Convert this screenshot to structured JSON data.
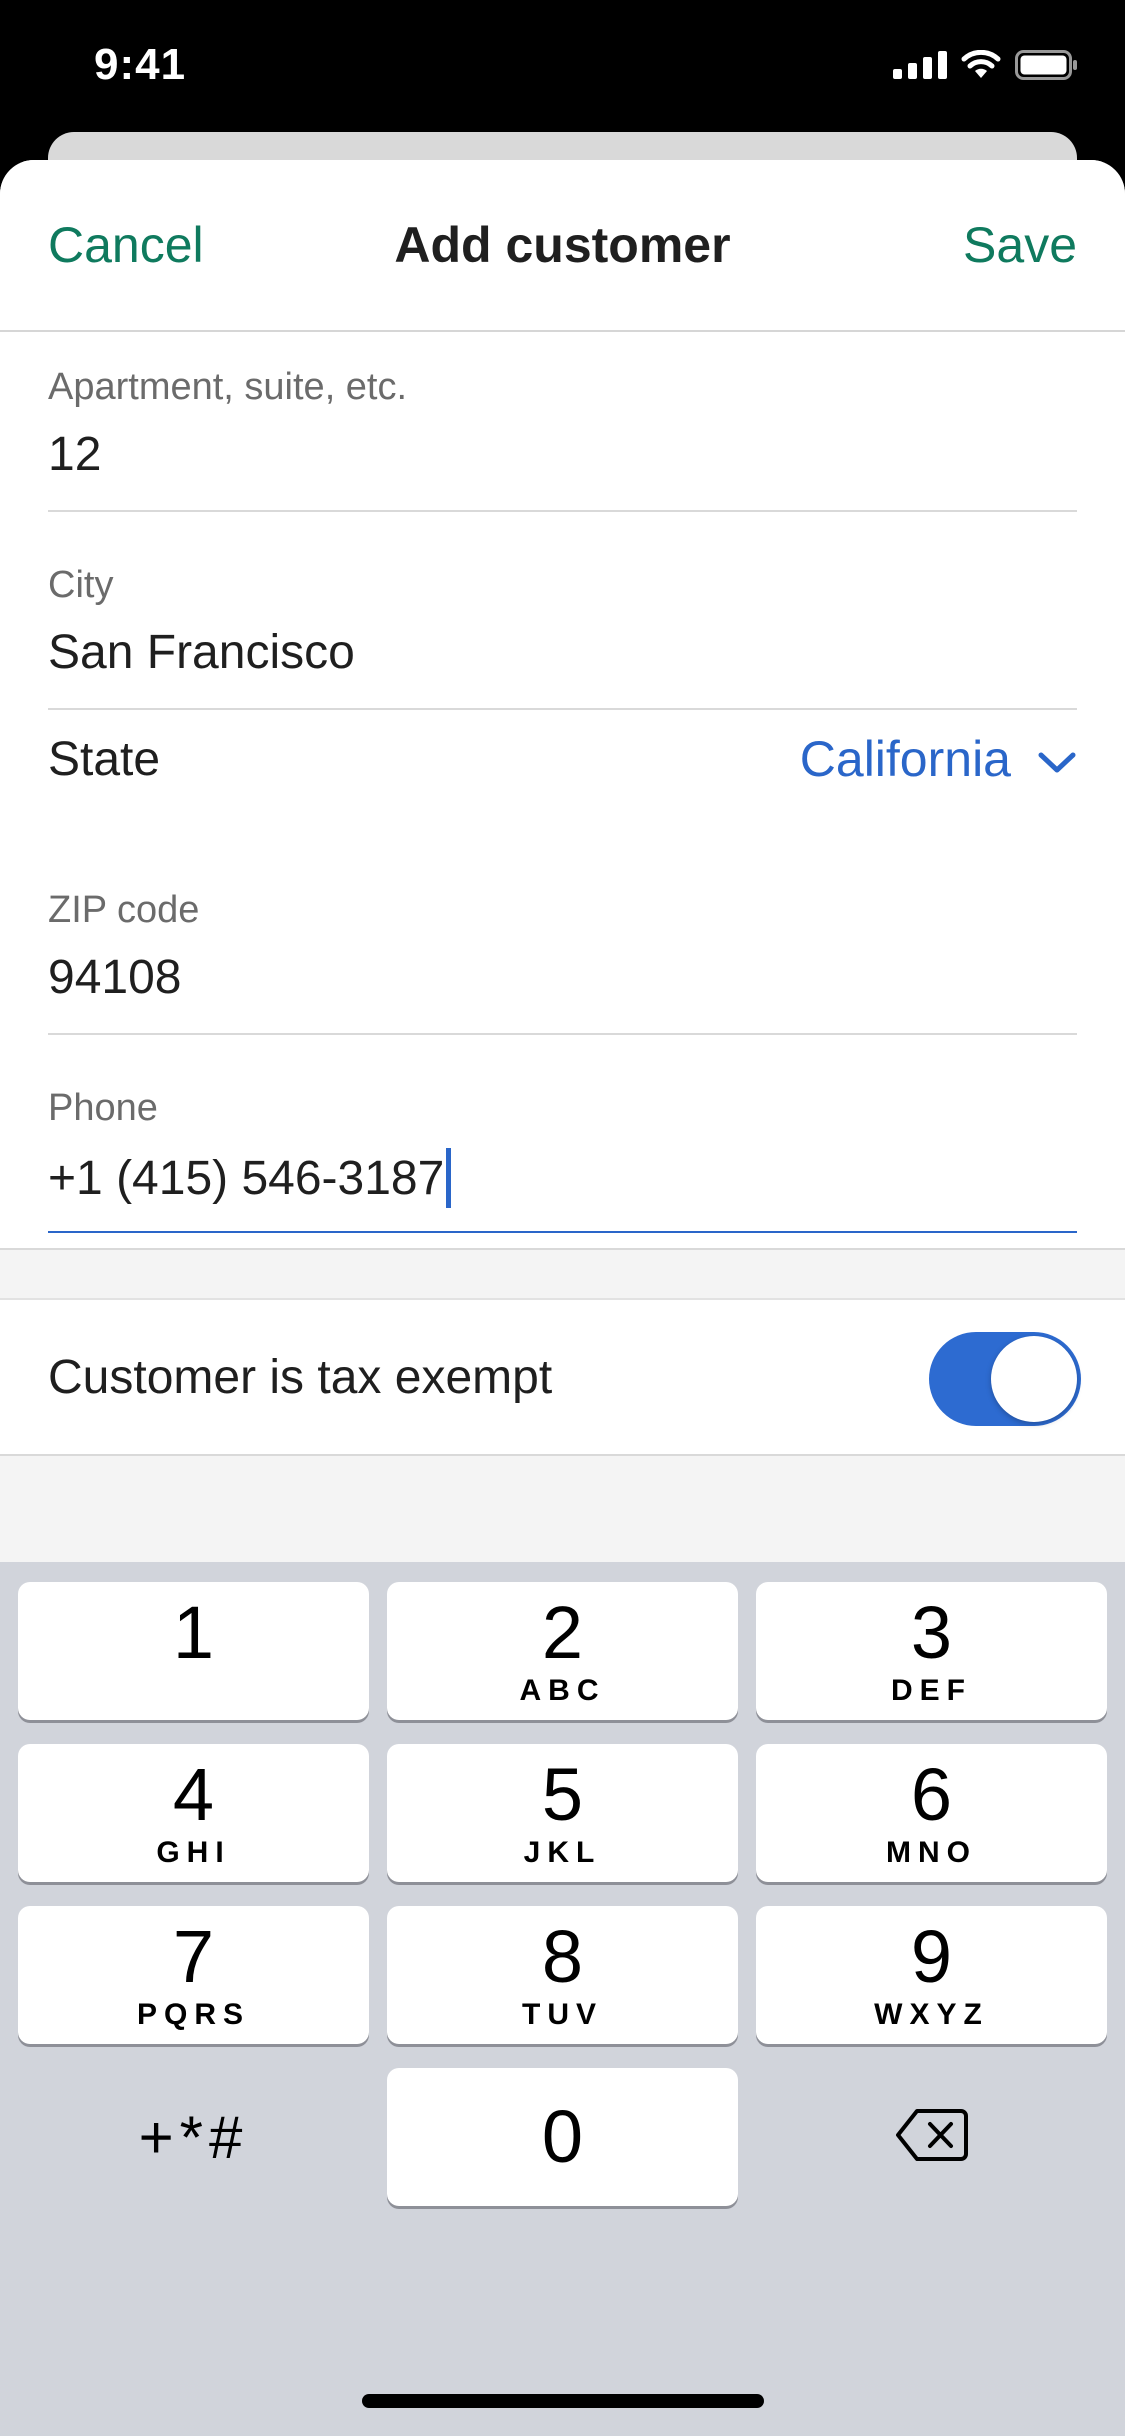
{
  "status_bar": {
    "time": "9:41"
  },
  "nav": {
    "cancel_label": "Cancel",
    "title": "Add customer",
    "save_label": "Save"
  },
  "form": {
    "apartment": {
      "label": "Apartment, suite, etc.",
      "value": "12"
    },
    "city": {
      "label": "City",
      "value": "San Francisco"
    },
    "state": {
      "label": "State",
      "value": "California"
    },
    "zip": {
      "label": "ZIP code",
      "value": "94108"
    },
    "phone": {
      "label": "Phone",
      "value": "+1 (415) 546-3187"
    }
  },
  "tax_exempt": {
    "label": "Customer is tax exempt",
    "enabled": true
  },
  "keyboard": {
    "keys": [
      {
        "num": "1",
        "letters": ""
      },
      {
        "num": "2",
        "letters": "ABC"
      },
      {
        "num": "3",
        "letters": "DEF"
      },
      {
        "num": "4",
        "letters": "GHI"
      },
      {
        "num": "5",
        "letters": "JKL"
      },
      {
        "num": "6",
        "letters": "MNO"
      },
      {
        "num": "7",
        "letters": "PQRS"
      },
      {
        "num": "8",
        "letters": "TUV"
      },
      {
        "num": "9",
        "letters": "WXYZ"
      },
      {
        "num": "0",
        "letters": ""
      }
    ],
    "symbols_label": "+*#"
  },
  "colors": {
    "accent_green": "#0f7a5e",
    "accent_blue": "#2a66c9",
    "toggle_on": "#2d6bd1"
  },
  "icons": [
    "cellular-signal-icon",
    "wifi-icon",
    "battery-icon",
    "chevron-down-icon",
    "delete-backspace-icon"
  ]
}
